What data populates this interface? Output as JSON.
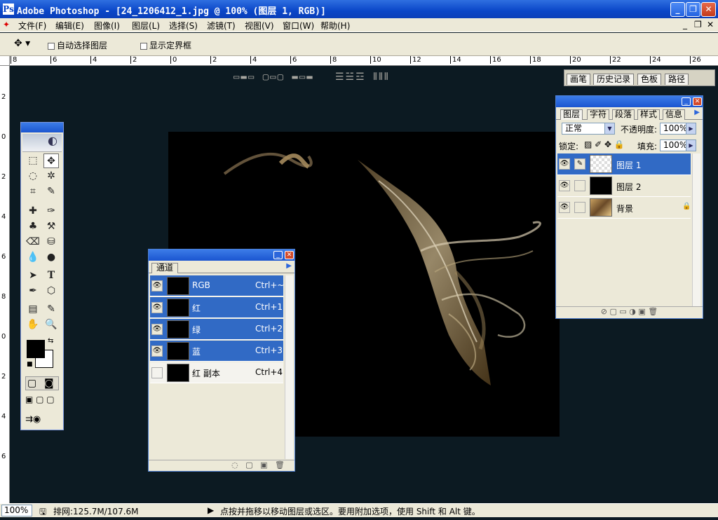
{
  "window": {
    "title": "Adobe Photoshop - [24_1206412_1.jpg @ 100% (图层 1, RGB)]",
    "logo": "Ps",
    "buttons": {
      "minimize": "_",
      "maximize": "❐",
      "close": "✕"
    },
    "doc_buttons": [
      "_",
      "❐",
      "✕"
    ]
  },
  "menu": [
    "文件(F)",
    "编辑(E)",
    "图像(I)",
    "图层(L)",
    "选择(S)",
    "滤镜(T)",
    "视图(V)",
    "窗口(W)",
    "帮助(H)"
  ],
  "options": {
    "move_tool_icon": "move-tool-icon",
    "auto_select_label": "自动选择图层",
    "show_bounds_label": "显示定界框",
    "align_icons": "▭▬▭ ▢▭▢ ▬▭▬",
    "distribute_icons": "☰☱☲ ⫴⫴⫴",
    "dock_tabs": [
      "画笔",
      "历史记录",
      "色板",
      "路径"
    ]
  },
  "ruler": {
    "h_labels": [
      "8",
      "6",
      "4",
      "2",
      "0",
      "2",
      "4",
      "6",
      "8",
      "10",
      "12",
      "14",
      "16",
      "18",
      "20",
      "22",
      "24",
      "26"
    ],
    "v_labels": [
      "2",
      "0",
      "2",
      "4",
      "6",
      "8",
      "0",
      "2",
      "4",
      "6"
    ]
  },
  "status": {
    "zoom": "100%",
    "memory": "排网:125.7M/107.6M",
    "hint": "点按并拖移以移动图层或选区。要用附加选项，使用 Shift 和 Alt 键。"
  },
  "toolbox": {
    "tools": [
      "⬚",
      "✥",
      "◌",
      "✲",
      "⌗",
      "✎",
      "✚",
      "✑",
      "♣",
      "⚒",
      "⌫",
      "⛁",
      "💧",
      "●",
      "➤",
      "T",
      "✒",
      "⬡",
      "▤",
      "✎",
      "✋",
      "🔍"
    ]
  },
  "channels": {
    "tab": "通道",
    "rows": [
      {
        "name": "RGB",
        "shortcut": "Ctrl+~",
        "visible": true,
        "selected": true
      },
      {
        "name": "红",
        "shortcut": "Ctrl+1",
        "visible": true,
        "selected": true
      },
      {
        "name": "绿",
        "shortcut": "Ctrl+2",
        "visible": true,
        "selected": true
      },
      {
        "name": "蓝",
        "shortcut": "Ctrl+3",
        "visible": true,
        "selected": true
      },
      {
        "name": "红 副本",
        "shortcut": "Ctrl+4",
        "visible": false,
        "selected": false
      }
    ]
  },
  "layers": {
    "tabs": [
      "图层",
      "字符",
      "段落",
      "样式",
      "信息"
    ],
    "blend_mode": "正常",
    "opacity_label": "不透明度:",
    "opacity": "100%",
    "lock_label": "锁定:",
    "fill_label": "填充:",
    "fill": "100%",
    "rows": [
      {
        "name": "图层 1",
        "selected": true,
        "locked": false
      },
      {
        "name": "图层 2",
        "selected": false,
        "locked": false
      },
      {
        "name": "背景",
        "selected": false,
        "locked": true
      }
    ]
  },
  "colors": {
    "accent": "#316ac5",
    "title": "#0a46c8",
    "workspace": "#0c1a22"
  }
}
